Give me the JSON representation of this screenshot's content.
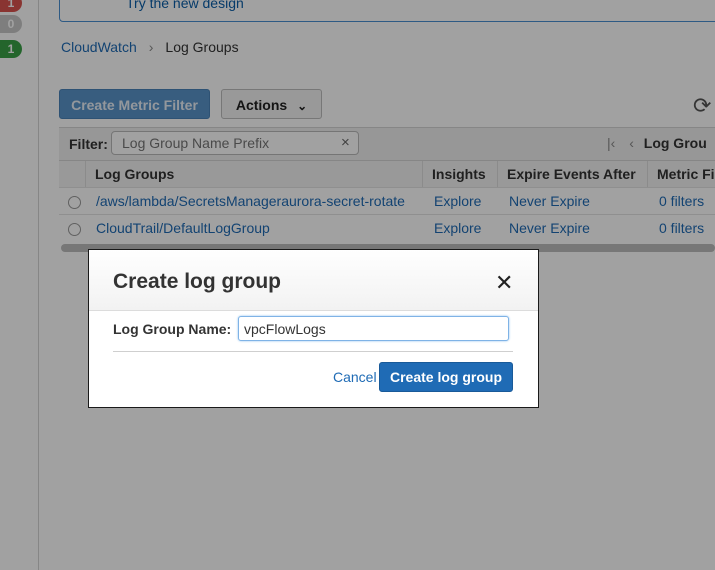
{
  "rail": {
    "badges": [
      {
        "count": "1",
        "color": "#d9534f"
      },
      {
        "count": "0",
        "color": "#aaaaaa"
      },
      {
        "count": "1",
        "color": "#3aa047"
      }
    ]
  },
  "banner": {
    "link": "Try the new design"
  },
  "breadcrumb": {
    "root": "CloudWatch",
    "separator": "›",
    "current": "Log Groups"
  },
  "toolbar": {
    "create_metric_filter": "Create Metric Filter",
    "actions": "Actions",
    "actions_caret": "⌄",
    "refresh_icon": "⟳"
  },
  "filter": {
    "label": "Filter:",
    "placeholder": "Log Group Name Prefix",
    "clear": "×"
  },
  "pager": {
    "first": "|‹",
    "prev": "‹",
    "label": "Log Grou"
  },
  "table": {
    "headers": [
      "Log Groups",
      "Insights",
      "Expire Events After",
      "Metric Fi"
    ],
    "rows": [
      {
        "name": "/aws/lambda/SecretsManageraurora-secret-rotate",
        "insights": "Explore",
        "expire": "Never Expire",
        "metric": "0 filters"
      },
      {
        "name": "CloudTrail/DefaultLogGroup",
        "insights": "Explore",
        "expire": "Never Expire",
        "metric": "0 filters"
      }
    ]
  },
  "modal": {
    "title": "Create log group",
    "close": "✕",
    "field_label": "Log Group Name:",
    "field_value": "vpcFlowLogs",
    "cancel": "Cancel",
    "submit": "Create log group"
  }
}
